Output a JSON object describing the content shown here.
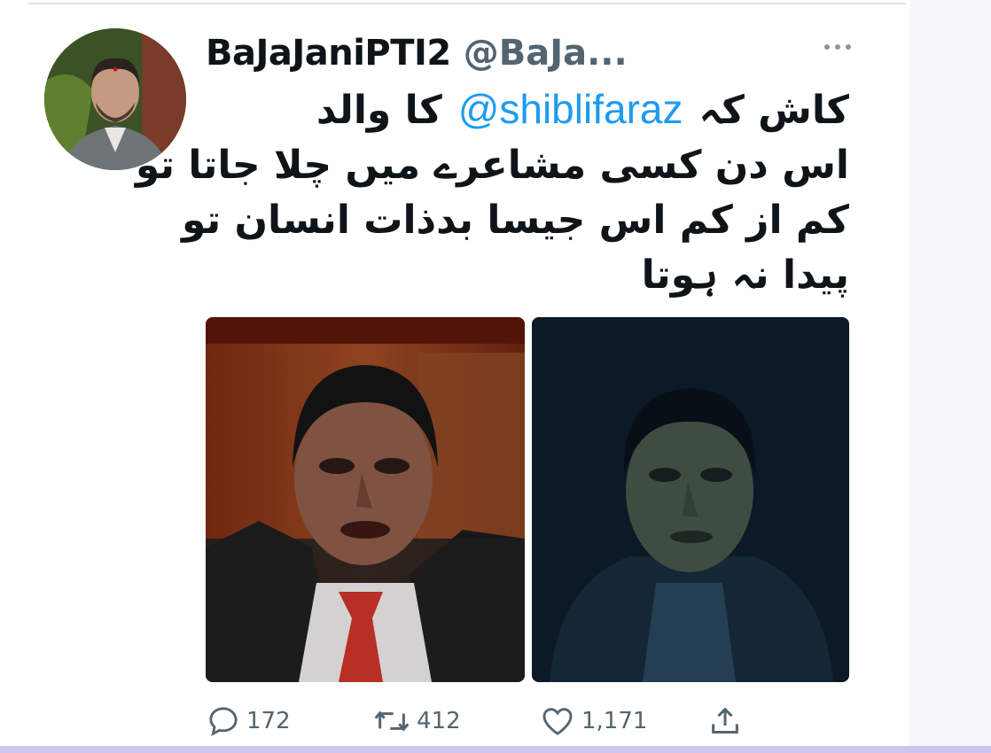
{
  "tweet": {
    "display_name": "BaJaJaniPTI2",
    "handle": "@BaJa...",
    "text_lines": [
      {
        "before": "کاش کہ",
        "mention": "@shiblifaraz",
        "after": "کا والد"
      },
      {
        "text": "اس دن کسی مشاعرے میں چلا جاتا تو"
      },
      {
        "text": "کم از کم اس جیسا بدذات  انسان تو"
      },
      {
        "text": "پیدا نہ ہوتا"
      }
    ]
  },
  "icons": {
    "more": "more-dots-icon",
    "reply": "reply-bubble-icon",
    "retweet": "retweet-arrows-icon",
    "like": "heart-icon",
    "share": "share-upload-icon"
  },
  "actions": {
    "replies": "172",
    "retweets": "412",
    "likes": "1,171"
  },
  "colors": {
    "text": "#0f1419",
    "secondary": "#536471",
    "mention": "#1d9bf0"
  }
}
